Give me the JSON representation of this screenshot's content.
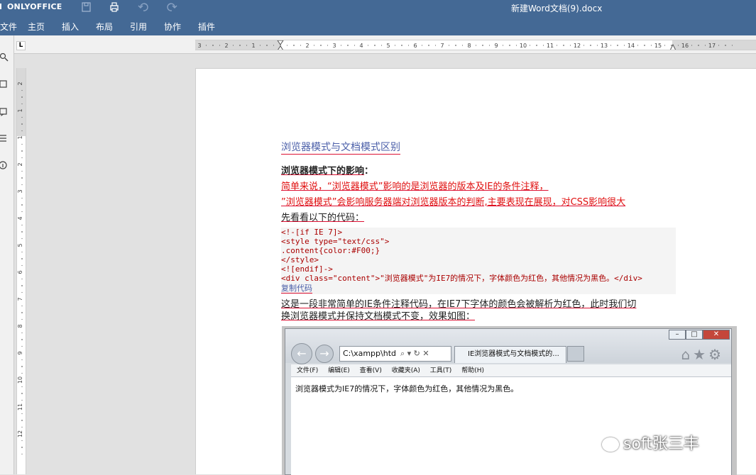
{
  "app": {
    "logo": "ONLYOFFICE",
    "doc_title": "新建Word文档(9).docx"
  },
  "menu": [
    "文件",
    "主页",
    "插入",
    "布局",
    "引用",
    "协作",
    "插件"
  ],
  "ruler": {
    "h_ticks": [
      "3",
      "2",
      "1",
      "1",
      "2",
      "3",
      "4",
      "5",
      "6",
      "7",
      "8",
      "9",
      "10",
      "11",
      "12",
      "13",
      "14",
      "15",
      "16",
      "17"
    ],
    "v_ticks": [
      "2",
      "1",
      "1",
      "2",
      "3",
      "4",
      "5",
      "6",
      "7",
      "8",
      "9",
      "10",
      "11",
      "12"
    ],
    "corner": "L"
  },
  "doc": {
    "heading": "浏览器模式与文档模式区别",
    "sub_heading": "浏览器模式下的影响",
    "sub_heading_colon": "：",
    "line1": "简单来说，“浏览器模式”影响的是浏览器的版本及IE的条件注释，",
    "line2": "”浏览器模式”会影响服务器端对浏览器版本的判断,主要表现在展现，对CSS影响很大",
    "line3": "先看看以下的代码：",
    "code": [
      "<!-[if IE 7]>",
      "<style type=\"text/css\">",
      ".content{color:#F00;}",
      "</style>",
      "<![endif]->",
      "<div class=\"content\">\"浏览器模式\"为IE7的情况下，字体颜色为红色，其他情况为黑色。</div>"
    ],
    "copy_label": "复制代码",
    "para1": "这是一段非常简单的IE条件注释代码，在IE7下字体的颜色会被解析为红色，此时我们切",
    "para2": "换浏览器模式并保持文档模式不变，效果如图："
  },
  "screenshot": {
    "address": "C:\\xampp\\htd",
    "tab_title": "IE浏览器模式与文档模式的...",
    "menu": [
      "文件(F)",
      "编辑(E)",
      "查看(V)",
      "收藏夹(A)",
      "工具(T)",
      "帮助(H)"
    ],
    "content": "浏览器模式为IE7的情况下，字体颜色为红色，其他情况为黑色。",
    "watermark": "soft张三丰"
  }
}
